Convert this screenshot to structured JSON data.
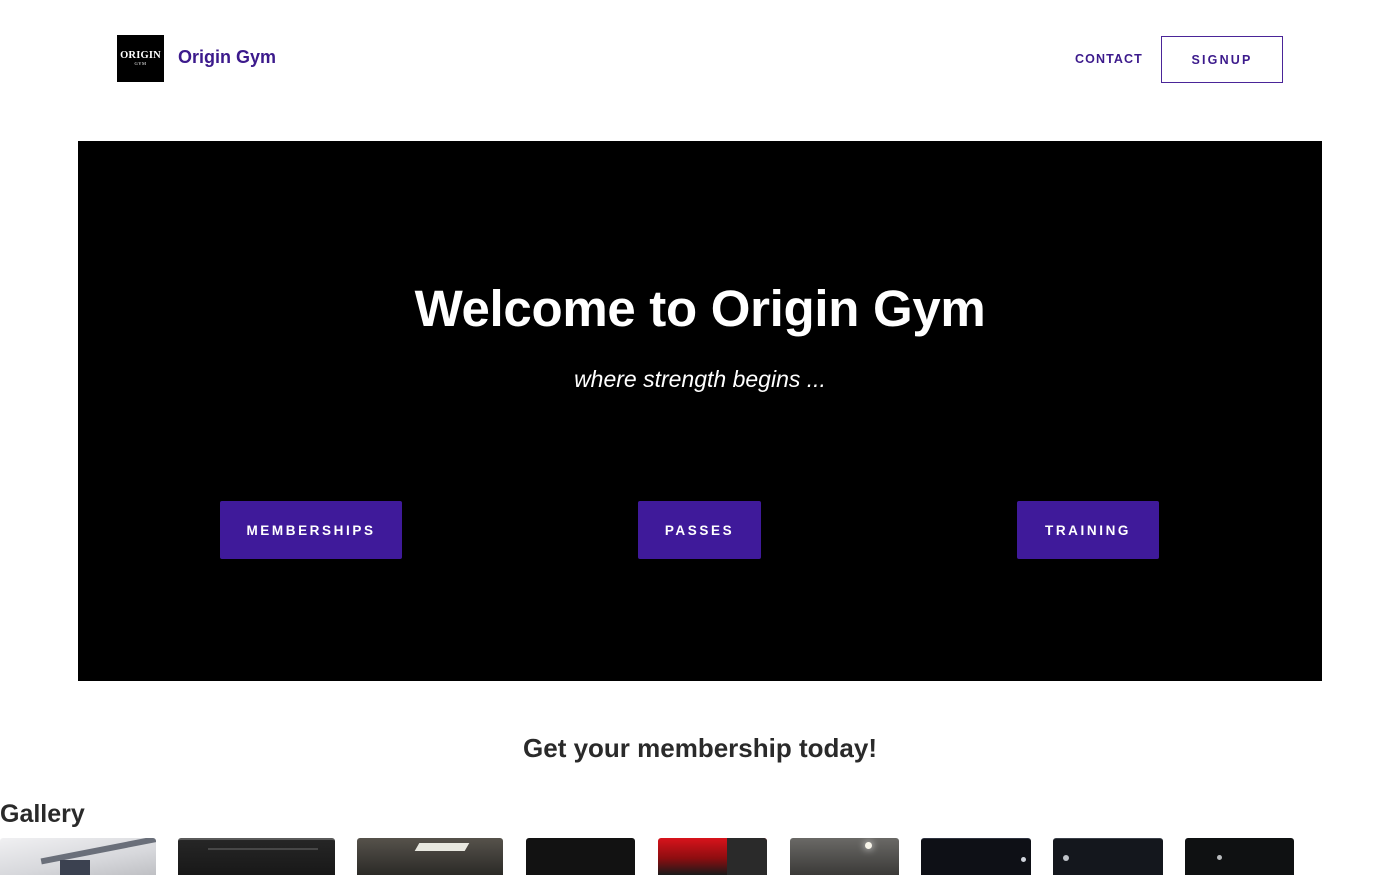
{
  "header": {
    "logo": {
      "line1": "ORIGIN",
      "line2": "GYM",
      "icon": "origin-gym-logo"
    },
    "brand_name": "Origin Gym",
    "nav": {
      "contact_label": "CONTACT",
      "signup_label": "SIGNUP"
    }
  },
  "hero": {
    "title": "Welcome to Origin Gym",
    "tagline": "where strength begins ...",
    "buttons": [
      {
        "label": "MEMBERSHIPS"
      },
      {
        "label": "PASSES"
      },
      {
        "label": "TRAINING"
      }
    ]
  },
  "cta": {
    "text": "Get your membership today!"
  },
  "gallery": {
    "title": "Gallery"
  },
  "colors": {
    "brand_purple": "#3c1a8c",
    "button_purple": "#3f1a9a",
    "hero_background": "#000000",
    "page_background": "#ffffff"
  }
}
